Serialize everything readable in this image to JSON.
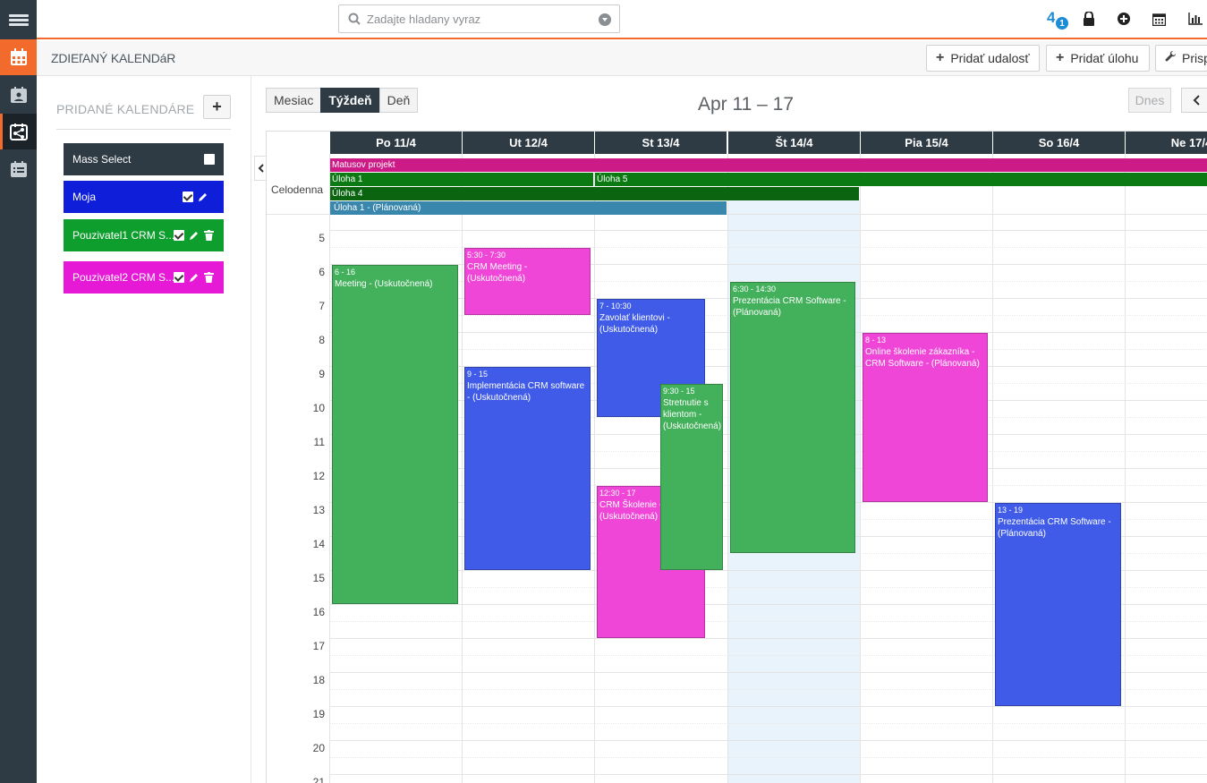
{
  "search": {
    "placeholder": "Zadajte hladany vyraz"
  },
  "notifications": {
    "count": "4",
    "badge": "1"
  },
  "page": {
    "title": "ZDIEľANÝ KALENDáR"
  },
  "toolbar": {
    "add_event": "Pridať udalosť",
    "add_task": "Pridať úlohu",
    "customize": "Prisp"
  },
  "sidebar": {
    "title": "PRIDANÉ KALENDÁRE",
    "add_label": "+",
    "calendars": [
      {
        "label": "Mass Select",
        "color": "#2f3b44"
      },
      {
        "label": "Moja",
        "color": "#0e1ed9"
      },
      {
        "label": "Pouzivatel1 CRM S...",
        "color": "#0e9e2e"
      },
      {
        "label": "Pouzivatel2 CRM S...",
        "color": "#e61ad6"
      }
    ]
  },
  "views": {
    "month": "Mesiac",
    "week": "Týždeň",
    "day": "Deň"
  },
  "range_title": "Apr 11 – 17",
  "today_label": "Dnes",
  "days": [
    "Po 11/4",
    "Ut 12/4",
    "St 13/4",
    "Št 14/4",
    "Pia 15/4",
    "So 16/4",
    "Ne 17/4"
  ],
  "allday_label": "Celodenna",
  "allday_events": [
    {
      "label": "Matusov projekt",
      "color": "#cc1a86"
    },
    {
      "label": "Úloha 1",
      "color": "#0b7a12"
    },
    {
      "label": "Úloha 5",
      "color": "#0b7a12"
    },
    {
      "label": "Úloha 4",
      "color": "#0b6410"
    },
    {
      "label": "Úloha 1 - (Plánovaná)",
      "color": "#3a87ad"
    }
  ],
  "hours": [
    "5",
    "6",
    "7",
    "8",
    "9",
    "10",
    "11",
    "12",
    "13",
    "14",
    "15",
    "16",
    "17",
    "18",
    "19",
    "20",
    "21"
  ],
  "events": [
    {
      "time": "6 - 16",
      "title": "Meeting - (Uskutočnená)",
      "color": "#43b05c"
    },
    {
      "time": "5:30 - 7:30",
      "title": "CRM Meeting - (Uskutočnená)",
      "color": "#f046d8"
    },
    {
      "time": "9 - 15",
      "title": "Implementácia CRM software - (Uskutočnená)",
      "color": "#3f5be8"
    },
    {
      "time": "7 - 10:30",
      "title": "Zavolať klientovi - (Uskutočnená)",
      "color": "#3f5be8"
    },
    {
      "time": "12:30 - 17",
      "title": "CRM Školenie - (Uskutočnená)",
      "color": "#f046d8"
    },
    {
      "time": "9:30 - 15",
      "title": "Stretnutie s klientom - (Uskutočnená)",
      "color": "#43b05c"
    },
    {
      "time": "6:30 - 14:30",
      "title": "Prezentácia CRM Software - (Plánovaná)",
      "color": "#43b05c"
    },
    {
      "time": "8 - 13",
      "title": "Online školenie zákazníka - CRM Software - (Plánovaná)",
      "color": "#f046d8"
    },
    {
      "time": "13 - 19",
      "title": "Prezentácia CRM Software - (Plánovaná)",
      "color": "#3f5be8"
    }
  ]
}
